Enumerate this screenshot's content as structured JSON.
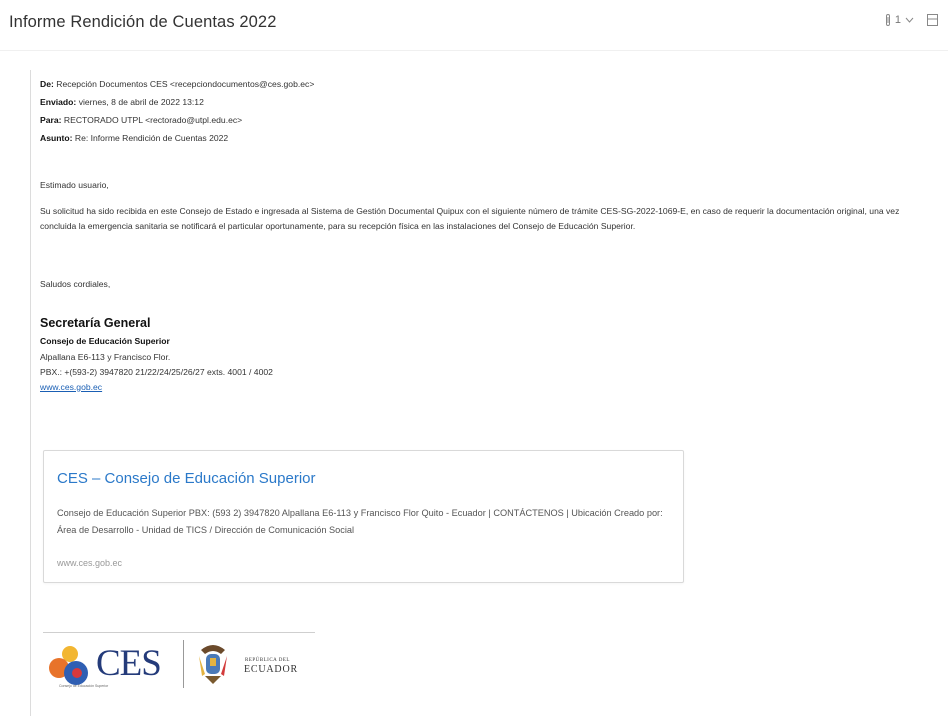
{
  "header": {
    "subject": "Informe Rendición de Cuentas 2022",
    "attachment_count": "1",
    "icons": [
      "attachment-icon",
      "chevron-down-icon",
      "expand-icon"
    ]
  },
  "message": {
    "from_label": "De:",
    "from_value": "Recepción Documentos CES <recepciondocumentos@ces.gob.ec>",
    "sent_label": "Enviado:",
    "sent_value": "viernes, 8 de abril de 2022 13:12",
    "to_label": "Para:",
    "to_value": "RECTORADO UTPL <rectorado@utpl.edu.ec>",
    "subject_label": "Asunto:",
    "subject_value": "Re: Informe Rendición de Cuentas 2022",
    "greeting": "Estimado usuario,",
    "body": "Su solicitud ha sido recibida en este Consejo de Estado e ingresada al Sistema de Gestión Documental Quipux con el siguiente número de trámite CES-SG-2022-1069-E, en caso de requerir la documentación original, una vez concluida la emergencia sanitaria se notificará el particular oportunamente, para su recepción física en las instalaciones del Consejo de Educación Superior.",
    "closing": "Saludos cordiales,"
  },
  "signature": {
    "title": "Secretaría General",
    "org": "Consejo de Educación Superior",
    "address": "Alpallana E6-113 y Francisco Flor.",
    "phone": "PBX.: +(593-2) 3947820 21/22/24/25/26/27  exts. 4001 / 4002",
    "link": "www.ces.gob.ec"
  },
  "preview_card": {
    "title": "CES – Consejo de Educación Superior",
    "description": "Consejo de Educación Superior PBX: (593 2) 3947820 Alpallana E6-113 y Francisco Flor Quito - Ecuador | CONTÁCTENOS | Ubicación Creado por: Área de Desarrollo - Unidad de TICS / Dirección de Comunicación Social",
    "url": "www.ces.gob.ec"
  },
  "logos": {
    "ces_text": "CES",
    "ces_subtitle": "Consejo de Educación Superior",
    "republic_small": "REPÚBLICA DEL",
    "republic_big": "ECUADOR",
    "colors": {
      "ces_navy": "#243b7a",
      "ces_yellow": "#f2b632",
      "ces_orange": "#e8732a",
      "ces_blue": "#2f5fb3",
      "ces_red": "#d8393b"
    }
  },
  "colors": {
    "link_blue": "#1a5fb4",
    "card_title_blue": "#2b79c9"
  }
}
